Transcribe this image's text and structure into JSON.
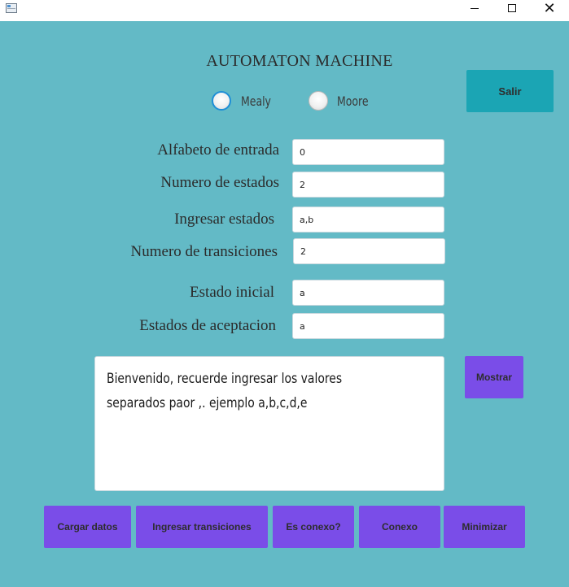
{
  "window": {
    "icon": "app-window-icon",
    "minimize_glyph": "",
    "maximize_glyph": "",
    "close_glyph": "✕"
  },
  "header": {
    "title": "AUTOMATON MACHINE",
    "exit_label": "Salir"
  },
  "machine_type": {
    "options": [
      "Mealy",
      "Moore"
    ],
    "selected": "Mealy"
  },
  "form": {
    "alphabet": {
      "label": "Alfabeto de entrada",
      "value": "0"
    },
    "num_states": {
      "label": "Numero de estados",
      "value": "2"
    },
    "states": {
      "label": "Ingresar estados",
      "value": "a,b"
    },
    "num_transitions": {
      "label": "Numero de transiciones",
      "value": "2"
    },
    "initial_state": {
      "label": "Estado inicial",
      "value": "a"
    },
    "accept_states": {
      "label": "Estados de aceptacion",
      "value": "a"
    }
  },
  "output": {
    "lines": [
      "Bienvenido, recuerde ingresar los valores",
      "separados paor ,. ejemplo a,b,c,d,e"
    ],
    "show_label": "Mostrar"
  },
  "actions": [
    "Cargar datos",
    "Ingresar transiciones",
    "Es conexo?",
    "Conexo",
    "Minimizar"
  ],
  "colors": {
    "background": "#63bac6",
    "exit_button": "#1ba5b4",
    "action_button": "#7a4de8",
    "radio_selected_border": "#1f8fd6"
  }
}
